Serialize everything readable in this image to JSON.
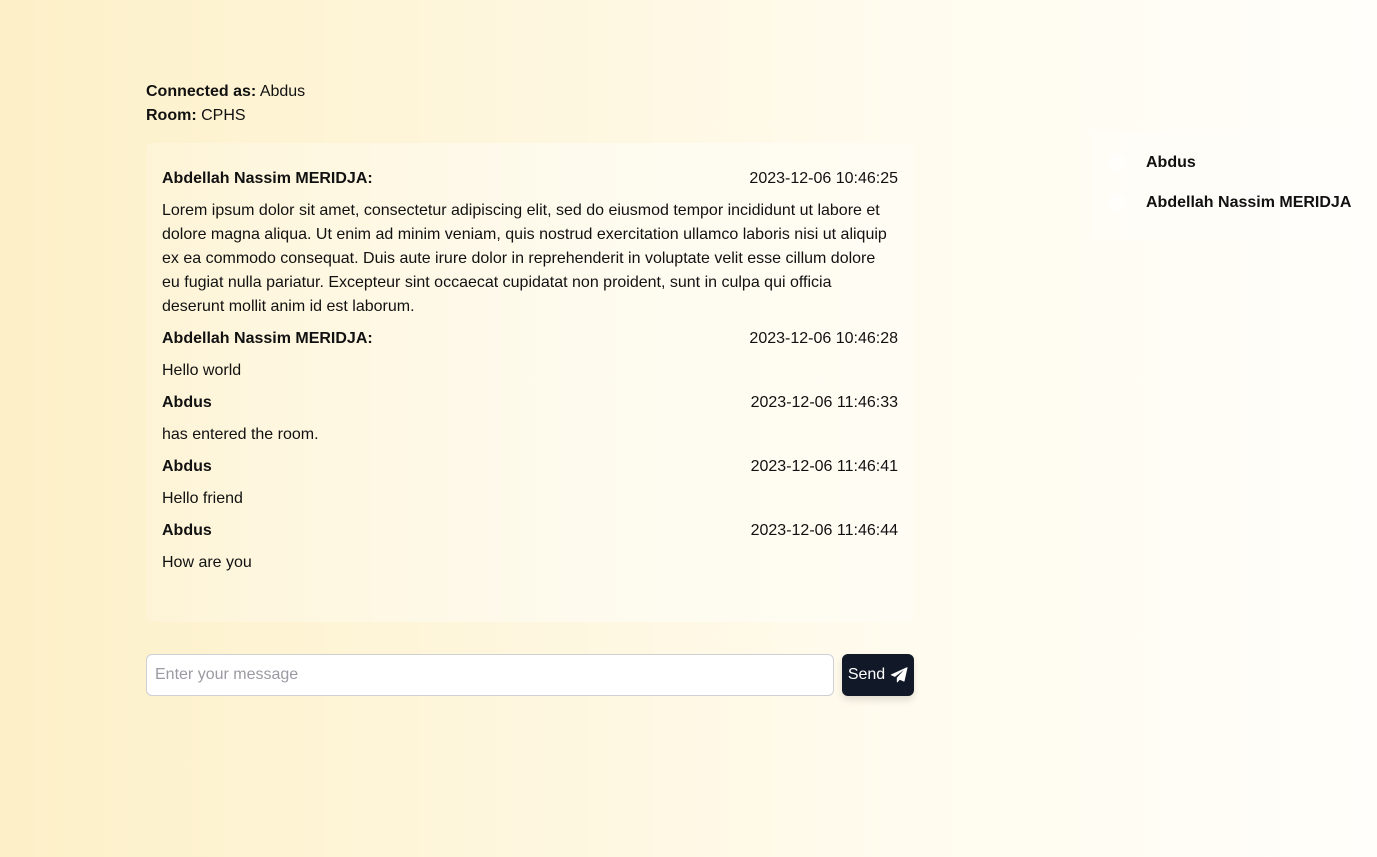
{
  "session": {
    "connected_label": "Connected as:",
    "connected_value": "Abdus",
    "room_label": "Room:",
    "room_value": "CPHS"
  },
  "messages": [
    {
      "author": "Abdellah Nassim MERIDJA:",
      "time": "2023-12-06 10:46:25",
      "text": "Lorem ipsum dolor sit amet, consectetur adipiscing elit, sed do eiusmod tempor incididunt ut labore et dolore magna aliqua. Ut enim ad minim veniam, quis nostrud exercitation ullamco laboris nisi ut aliquip ex ea commodo consequat. Duis aute irure dolor in reprehenderit in voluptate velit esse cillum dolore eu fugiat nulla pariatur. Excepteur sint occaecat cupidatat non proident, sunt in culpa qui officia deserunt mollit anim id est laborum."
    },
    {
      "author": "Abdellah Nassim MERIDJA:",
      "time": "2023-12-06 10:46:28",
      "text": "Hello world"
    },
    {
      "author": "Abdus",
      "time": "2023-12-06 11:46:33",
      "text": "has entered the room."
    },
    {
      "author": "Abdus",
      "time": "2023-12-06 11:46:41",
      "text": "Hello friend"
    },
    {
      "author": "Abdus",
      "time": "2023-12-06 11:46:44",
      "text": "How are you"
    }
  ],
  "composer": {
    "placeholder": "Enter your message",
    "value": "",
    "send_label": "Send",
    "send_icon": "paper-plane-icon"
  },
  "users": [
    {
      "name": "Abdus"
    },
    {
      "name": "Abdellah Nassim MERIDJA"
    }
  ],
  "colors": {
    "send_button_bg": "#111827",
    "background_left": "#fdf0c8",
    "background_right": "#fffefa"
  }
}
